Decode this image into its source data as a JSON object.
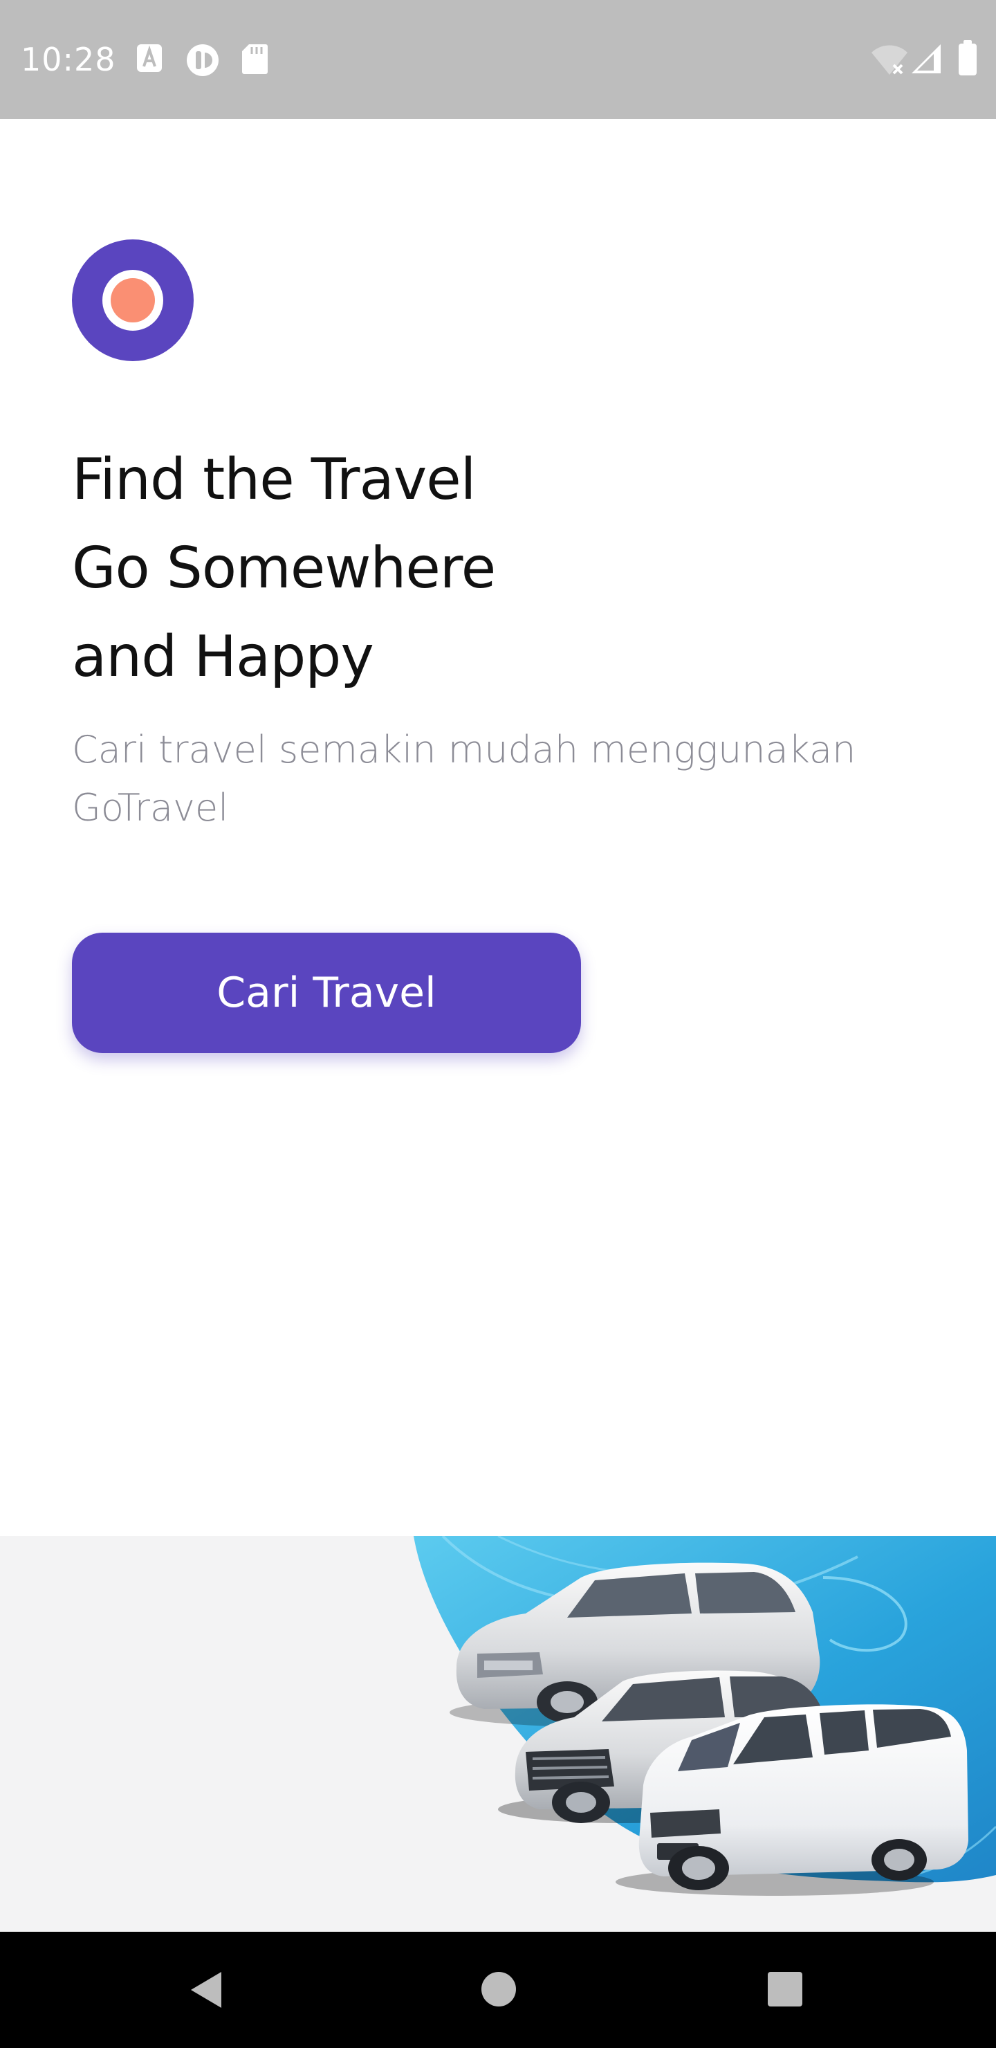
{
  "status_bar": {
    "time": "10:28",
    "notification_icons": [
      "accessibility-a-icon",
      "app-notification-icon",
      "sd-card-icon"
    ],
    "system_icons": [
      "wifi-off-icon",
      "cell-signal-icon",
      "battery-icon"
    ],
    "background_color": "#bdbdbd"
  },
  "app": {
    "logo_icon": "target-circle-logo-icon",
    "headline_lines": [
      "Find the Travel",
      "Go Somewhere",
      "and Happy"
    ],
    "subtitle": "Cari travel semakin mudah menggunakan GoTravel",
    "cta_label": "Cari Travel",
    "hero_image": "vehicles-illustration",
    "colors": {
      "primary": "#5a45bf",
      "accent": "#fa8f73",
      "headline": "#111111",
      "subtitle": "#8c8c96",
      "band_background": "#f3f3f4",
      "hero_blue": "#29a3dc"
    }
  },
  "nav_bar": {
    "buttons": [
      "back-icon",
      "home-icon",
      "recents-icon"
    ]
  }
}
